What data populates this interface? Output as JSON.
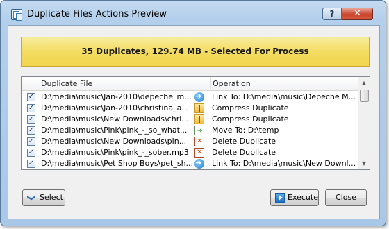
{
  "window": {
    "title": "Duplicate Files Actions Preview",
    "help_label": "?",
    "close_label": "✕"
  },
  "banner": {
    "text": "35 Duplicates, 129.74 MB - Selected For Process"
  },
  "table": {
    "columns": [
      "Duplicate File",
      "Operation"
    ],
    "rows": [
      {
        "checked": true,
        "file": "D:\\media\\music\\Jan-2010\\depeche_m...",
        "icon": "link-arrow-icon",
        "operation": "Link To: D:\\media\\music\\Depeche M..."
      },
      {
        "checked": true,
        "file": "D:\\media\\music\\Jan-2010\\christina_a...",
        "icon": "compress-icon",
        "operation": "Compress Duplicate"
      },
      {
        "checked": true,
        "file": "D:\\media\\music\\New Downloads\\chri...",
        "icon": "compress-icon",
        "operation": "Compress Duplicate"
      },
      {
        "checked": true,
        "file": "D:\\media\\music\\Pink\\pink_-_so_what...",
        "icon": "move-icon",
        "operation": "Move To: D:\\temp"
      },
      {
        "checked": true,
        "file": "D:\\media\\music\\New Downloads\\pin...",
        "icon": "delete-icon",
        "operation": "Delete Duplicate"
      },
      {
        "checked": true,
        "file": "D:\\media\\music\\Pink\\pink_-_sober.mp3",
        "icon": "delete-icon",
        "operation": "Delete Duplicate"
      },
      {
        "checked": true,
        "file": "D:\\media\\music\\Pet Shop Boys\\pet_sh...",
        "icon": "link-arrow-icon",
        "operation": "Link To: D:\\media\\music\\New Downl..."
      }
    ]
  },
  "buttons": {
    "select_label": "Select",
    "execute_label": "Execute",
    "close_label": "Close"
  },
  "scrollbar": {
    "up": "▲",
    "down": "▼"
  },
  "colors": {
    "banner": "#f3dc62",
    "link_icon": "#1f7ed1",
    "delete_icon": "#d23a12"
  }
}
